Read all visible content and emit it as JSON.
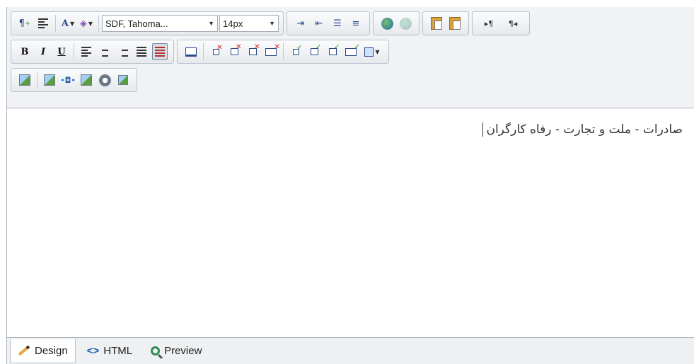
{
  "window": {
    "title": ""
  },
  "toolbar": {
    "row1": {
      "paragraph_icon": "paragraph-add-icon",
      "align_icon": "align-lines-icon",
      "font_color_label": "A",
      "highlight_icon": "paint-bucket-icon",
      "font_name": "SDF, Tahoma...",
      "font_size": "14px",
      "indent_icon": "indent-icon",
      "outdent_icon": "outdent-icon",
      "ordered_list_icon": "ordered-list-icon",
      "unordered_list_icon": "unordered-list-icon",
      "link_icon": "link-globe-icon",
      "unlink_icon": "unlink-globe-icon",
      "paste_text_icon": "paste-text-icon",
      "paste_icon": "paste-icon",
      "ltr_label": "▸¶",
      "rtl_label": "¶◂"
    },
    "row2": {
      "bold_label": "B",
      "italic_label": "I",
      "underline_label": "U",
      "align_left_icon": "align-left-icon",
      "align_center_icon": "align-center-icon",
      "align_right_icon": "align-right-icon",
      "justify_icon": "justify-icon",
      "clear_format_icon": "clear-format-icon"
    },
    "row3": {
      "insert_image_icon": "insert-image-icon",
      "image_map_icon": "image-map-icon",
      "flash_icon": "flash-icon",
      "media_icon": "media-icon",
      "template_icon": "template-icon",
      "gallery_icon": "gallery-icon"
    }
  },
  "content": {
    "text": "صادرات - ملت و تجارت - رفاه کارگران"
  },
  "tabs": [
    {
      "label": "Design",
      "icon": "pencil-icon",
      "active": true
    },
    {
      "label": "HTML",
      "icon": "code-icon",
      "active": false
    },
    {
      "label": "Preview",
      "icon": "magnifier-icon",
      "active": false
    }
  ],
  "colors": {
    "toolbar_bg": "#f1f2f4",
    "border": "#a9b1bb",
    "accent_blue": "#2b4a8b",
    "delete_red": "#d21f1f",
    "insert_green": "#2e9b2e"
  }
}
